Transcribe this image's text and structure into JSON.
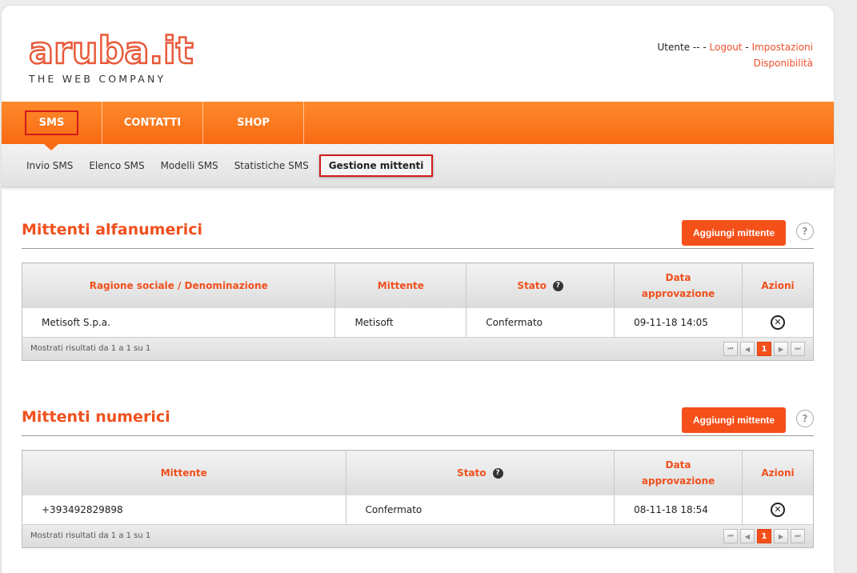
{
  "logo": {
    "word": "aruba.it",
    "tagline": "THE WEB COMPANY"
  },
  "user": {
    "label": "Utente -- - ",
    "logout": "Logout",
    "sep": " - ",
    "settings": "Impostazioni",
    "availability": "Disponibilità"
  },
  "nav": {
    "items": [
      {
        "label": "SMS"
      },
      {
        "label": "CONTATTI"
      },
      {
        "label": "SHOP"
      }
    ]
  },
  "subnav": {
    "items": [
      {
        "label": "Invio SMS"
      },
      {
        "label": "Elenco SMS"
      },
      {
        "label": "Modelli SMS"
      },
      {
        "label": "Statistiche SMS"
      },
      {
        "label": "Gestione mittenti"
      }
    ]
  },
  "alpha": {
    "title": "Mittenti alfanumerici",
    "add_label": "Aggiungi mittente",
    "help": "?",
    "headers": {
      "ragione": "Ragione sociale / Denominazione",
      "mittente": "Mittente",
      "stato": "Stato",
      "data": "Data approvazione",
      "azioni": "Azioni"
    },
    "row": {
      "ragione": "Metisoft S.p.a.",
      "mittente": "Metisoft",
      "stato": "Confermato",
      "data": "09-11-18 14:05"
    },
    "pager_info": "Mostrati risultati da 1 a 1 su 1",
    "page": "1"
  },
  "numeric": {
    "title": "Mittenti numerici",
    "add_label": "Aggiungi mittente",
    "help": "?",
    "headers": {
      "mittente": "Mittente",
      "stato": "Stato",
      "data": "Data approvazione",
      "azioni": "Azioni"
    },
    "row": {
      "mittente": "+393492829898",
      "stato": "Confermato",
      "data": "08-11-18 18:54"
    },
    "pager_info": "Mostrati risultati da 1 a 1 su 1",
    "page": "1"
  },
  "icons": {
    "status_help": "?",
    "delete": "✕",
    "first": "⏮",
    "prev": "◀",
    "next": "▶",
    "last": "⏭"
  },
  "colors": {
    "accent": "#f5501a",
    "nav_top": "#fe8a2c",
    "nav_bottom": "#f96a14",
    "highlight": "#d11a1a"
  }
}
